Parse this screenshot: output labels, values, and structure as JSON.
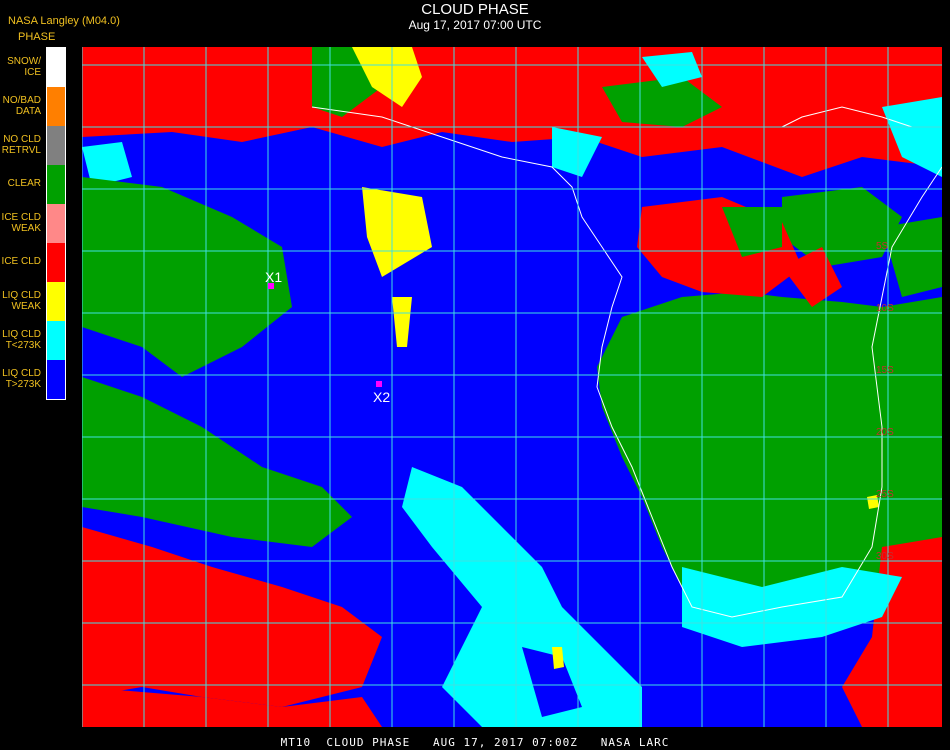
{
  "header": {
    "credit": "NASA Langley (M04.0)",
    "title": "CLOUD PHASE",
    "subtitle": "Aug 17, 2017 07:00 UTC"
  },
  "legend": {
    "title": "PHASE",
    "items": [
      {
        "label": "SNOW/\nICE",
        "color": "#ffffff"
      },
      {
        "label": "NO/BAD\nDATA",
        "color": "#ff7f00"
      },
      {
        "label": "NO CLD\nRETRVL",
        "color": "#808080"
      },
      {
        "label": "CLEAR",
        "color": "#00a000"
      },
      {
        "label": "ICE CLD\nWEAK",
        "color": "#ff8888"
      },
      {
        "label": "ICE CLD",
        "color": "#ff0000"
      },
      {
        "label": "LIQ CLD\nWEAK",
        "color": "#ffff00"
      },
      {
        "label": "LIQ CLD\nT<273K",
        "color": "#00ffff"
      },
      {
        "label": "LIQ CLD\nT>273K",
        "color": "#0000ff"
      }
    ]
  },
  "map": {
    "markers": [
      {
        "label": "X1",
        "color": "#ff00ff"
      },
      {
        "label": "X2",
        "color": "#ff00ff"
      }
    ],
    "lat_labels": [
      "5S",
      "10S",
      "15S",
      "20S",
      "25S",
      "30S"
    ]
  },
  "footer": "MT10  CLOUD PHASE   AUG 17, 2017 07:00Z   NASA LARC"
}
